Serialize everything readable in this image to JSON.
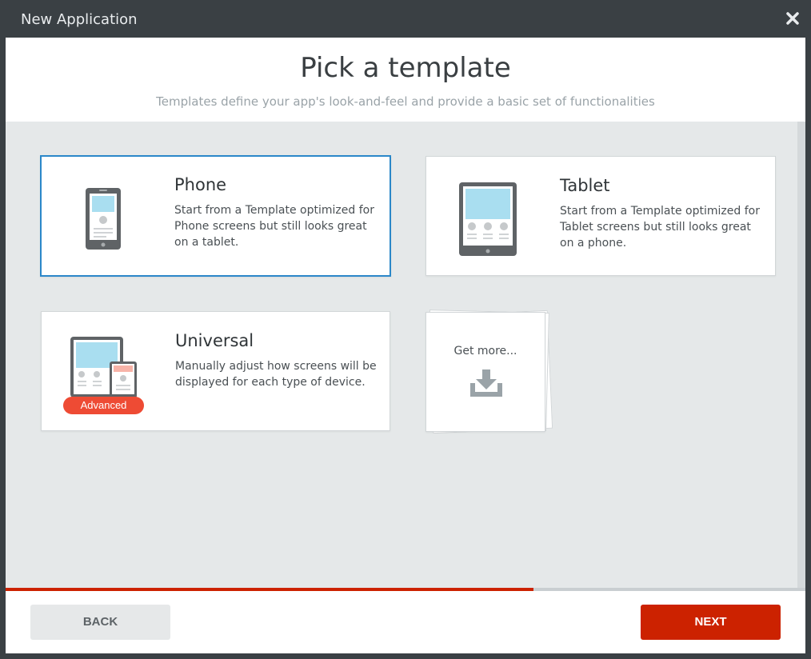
{
  "window": {
    "title": "New Application",
    "close_icon": "close-icon"
  },
  "header": {
    "heading": "Pick a template",
    "subheading": "Templates define your app's look-and-feel and provide a basic set of functionalities"
  },
  "templates": [
    {
      "id": "phone",
      "title": "Phone",
      "description": "Start from a Template optimized for Phone screens but still looks great on a tablet.",
      "selected": true,
      "icon": "phone-icon"
    },
    {
      "id": "tablet",
      "title": "Tablet",
      "description": "Start from a Template optimized for Tablet screens but still looks great on a phone.",
      "selected": false,
      "icon": "tablet-icon"
    },
    {
      "id": "universal",
      "title": "Universal",
      "description": "Manually adjust how screens will be displayed for each type of device.",
      "selected": false,
      "icon": "universal-devices-icon",
      "badge": "Advanced"
    }
  ],
  "get_more": {
    "label": "Get more...",
    "icon": "download-icon"
  },
  "progress": {
    "fraction": 0.66
  },
  "footer": {
    "back_label": "BACK",
    "next_label": "NEXT"
  },
  "colors": {
    "accent": "#cc2200",
    "selected_border": "#2b87c9",
    "badge": "#ee4b34",
    "titlebar": "#3a4044"
  }
}
